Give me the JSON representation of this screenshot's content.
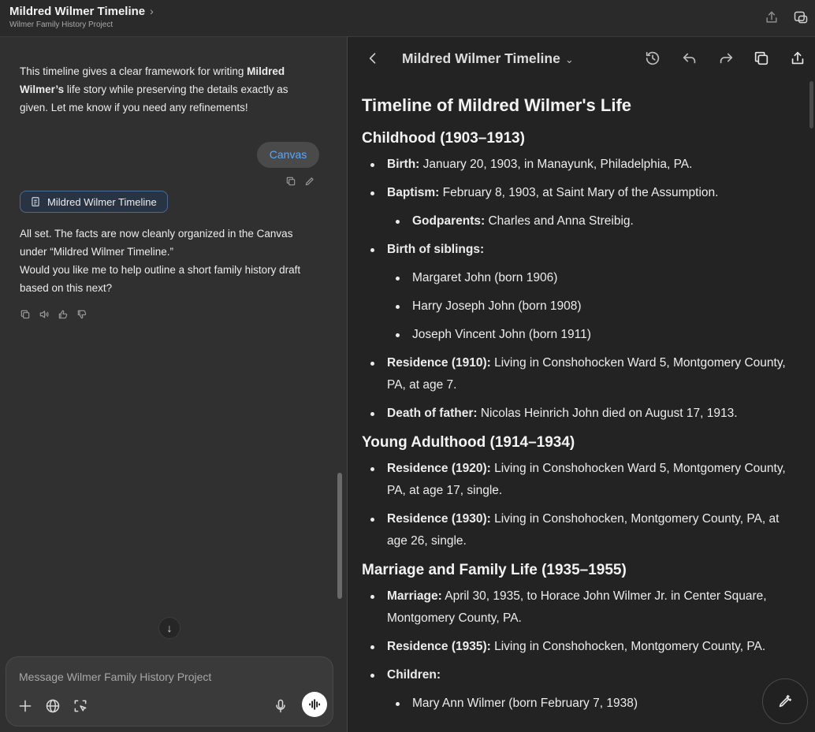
{
  "header": {
    "title": "Mildred Wilmer Timeline",
    "subtitle": "Wilmer Family History Project",
    "chevron": "›",
    "icons": [
      "share-icon",
      "new-window-icon"
    ]
  },
  "chat": {
    "assistant_msg1": {
      "pre": "This timeline gives a clear framework for writing ",
      "bold": "Mildred Wilmer’s",
      "post": " life story while preserving the details exactly as given. Let me know if you need any refinements!"
    },
    "user_msg": "Canvas",
    "canvas_chip_label": "Mildred Wilmer Timeline",
    "assistant_msg2": {
      "line1": "All set. The facts are now cleanly organized in the Canvas under “Mildred Wilmer Timeline.”",
      "line2": "Would you like me to help outline a short family history draft based on this next?"
    },
    "scroll_down_glyph": "↓"
  },
  "composer": {
    "placeholder": "Message Wilmer Family History Project"
  },
  "canvas": {
    "title": "Mildred Wilmer Timeline",
    "dropdown_glyph": "⌄",
    "doc_title": "Timeline of Mildred Wilmer's Life",
    "sections": [
      {
        "heading": "Childhood (1903–1913)",
        "items": [
          {
            "label": "Birth:",
            "text": " January 20, 1903, in Manayunk, Philadelphia, PA."
          },
          {
            "label": "Baptism:",
            "text": " February 8, 1903, at Saint Mary of the Assumption."
          },
          {
            "label": "Godparents:",
            "text": " Charles and Anna Streibig."
          },
          {
            "label": "Birth of siblings:",
            "text": ""
          },
          {
            "label": "",
            "text": "Margaret John (born 1906)"
          },
          {
            "label": "",
            "text": "Harry Joseph John (born 1908)"
          },
          {
            "label": "",
            "text": "Joseph Vincent John (born 1911)"
          },
          {
            "label": "Residence (1910):",
            "text": " Living in Conshohocken Ward 5, Montgomery County, PA, at age 7."
          },
          {
            "label": "Death of father:",
            "text": " Nicolas Heinrich John died on August 17, 1913."
          }
        ]
      },
      {
        "heading": "Young Adulthood (1914–1934)",
        "items": [
          {
            "label": "Residence (1920):",
            "text": " Living in Conshohocken Ward 5, Montgomery County, PA, at age 17, single."
          },
          {
            "label": "Residence (1930):",
            "text": " Living in Conshohocken, Montgomery County, PA, at age 26, single."
          }
        ]
      },
      {
        "heading": "Marriage and Family Life (1935–1955)",
        "items": [
          {
            "label": "Marriage:",
            "text": " April 30, 1935, to Horace John Wilmer Jr. in Center Square, Montgomery County, PA."
          },
          {
            "label": "Residence (1935):",
            "text": " Living in Conshohocken, Montgomery County, PA."
          },
          {
            "label": "Children:",
            "text": ""
          },
          {
            "label": "",
            "text": "Mary Ann Wilmer (born February 7, 1938)"
          }
        ]
      }
    ]
  }
}
